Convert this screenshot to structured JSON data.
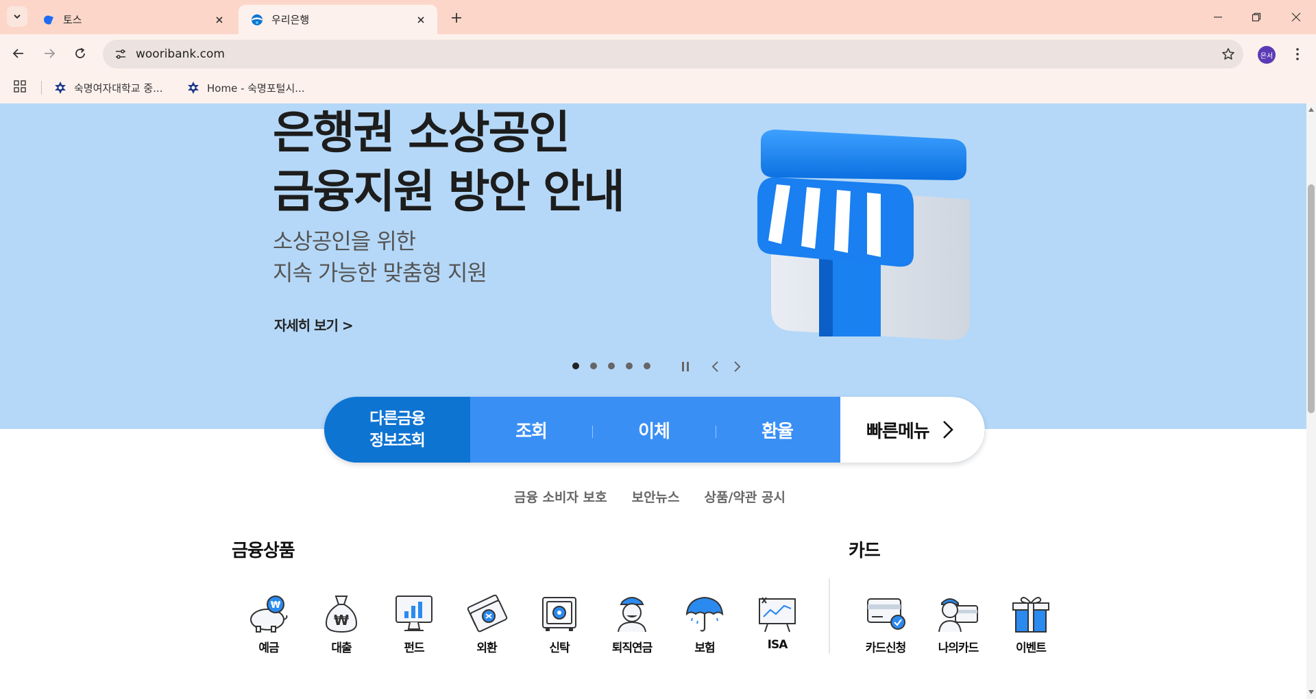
{
  "browser": {
    "tabs": [
      {
        "title": "토스",
        "active": false,
        "favicon": "toss-logo-icon"
      },
      {
        "title": "우리은행",
        "active": true,
        "favicon": "woori-logo-icon"
      }
    ],
    "address": "wooribank.com",
    "profile_initials": "은서",
    "bookmarks": [
      {
        "label": "숙명여자대학교 중..."
      },
      {
        "label": "Home - 숙명포털시..."
      }
    ]
  },
  "hero": {
    "title_line1": "은행권 소상공인",
    "title_line2": "금융지원 방안 안내",
    "sub_line1": "소상공인을 위한",
    "sub_line2": "지속 가능한 맞춤형 지원",
    "more_link": "자세히 보기 >",
    "slide_count": 5,
    "current_slide": 1,
    "bg_color": "#b5d8f8"
  },
  "quick_menu": {
    "other_line1": "다른금융",
    "other_line2": "정보조회",
    "items": [
      "조회",
      "이체",
      "환율"
    ],
    "fast_menu": "빠른메뉴"
  },
  "links": [
    "금융 소비자 보호",
    "보안뉴스",
    "상품/약관 공시"
  ],
  "products": {
    "title": "금융상품",
    "items": [
      {
        "label": "예금",
        "icon": "piggy-bank-icon"
      },
      {
        "label": "대출",
        "icon": "money-bag-icon"
      },
      {
        "label": "펀드",
        "icon": "chart-monitor-icon"
      },
      {
        "label": "외환",
        "icon": "currency-exchange-icon"
      },
      {
        "label": "신탁",
        "icon": "safe-icon"
      },
      {
        "label": "퇴직연금",
        "icon": "retiree-icon"
      },
      {
        "label": "보험",
        "icon": "umbrella-icon"
      },
      {
        "label": "ISA",
        "icon": "isa-board-icon"
      }
    ]
  },
  "cards": {
    "title": "카드",
    "items": [
      {
        "label": "카드신청",
        "icon": "card-apply-icon"
      },
      {
        "label": "나의카드",
        "icon": "my-card-icon"
      },
      {
        "label": "이벤트",
        "icon": "gift-icon"
      }
    ]
  }
}
